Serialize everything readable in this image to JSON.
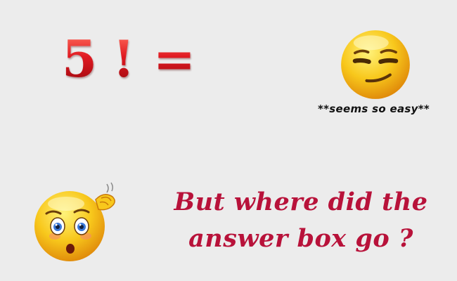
{
  "equation": {
    "five": "5",
    "bang": "!",
    "equals": "=",
    "question_mark": "?"
  },
  "smirk_emoji": {
    "icon": "smirking-face-emoji",
    "caption": "**seems so easy**"
  },
  "confused_emoji": {
    "icon": "confused-scratching-head-emoji"
  },
  "question": {
    "line1": "But where did the",
    "line2": "answer box go ?"
  },
  "colors": {
    "background": "#ececec",
    "equation_red": "#c0111f",
    "question_text": "#b8123a",
    "emoji_yellow": "#f7c21a"
  }
}
